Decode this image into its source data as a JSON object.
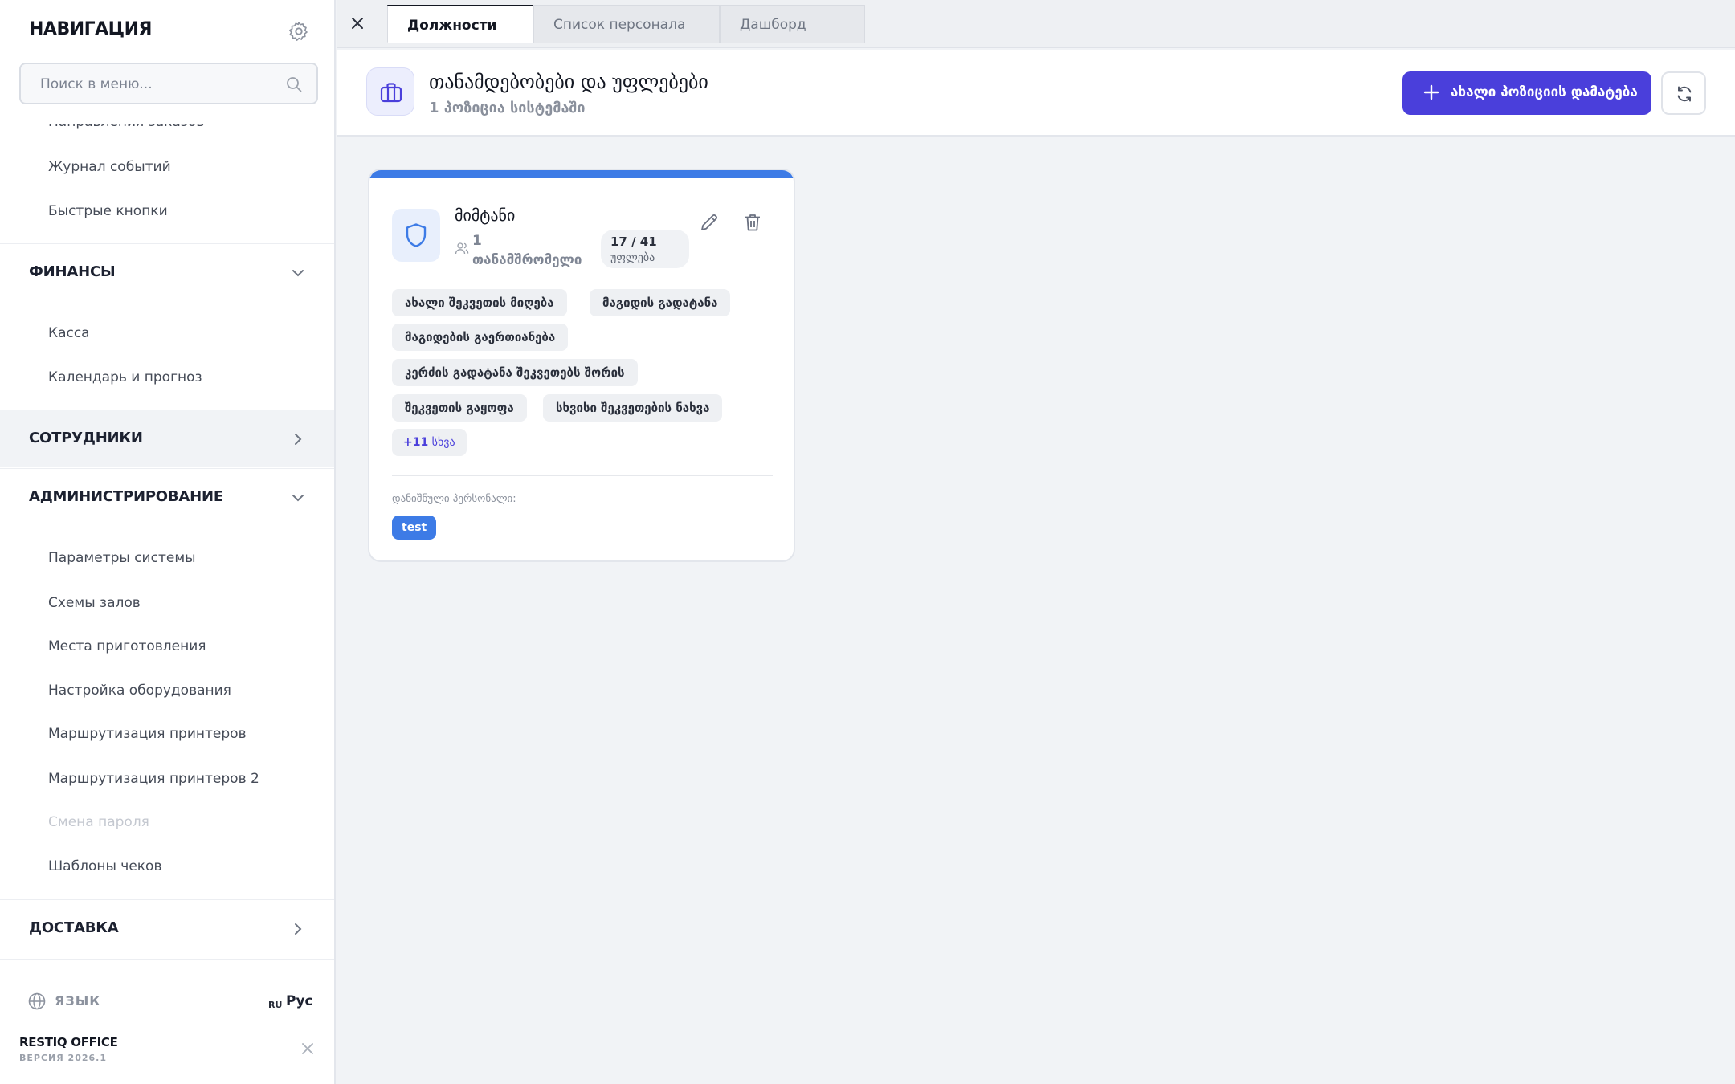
{
  "sidebar": {
    "title": "НАВИГАЦИЯ",
    "search_placeholder": "Поиск в меню...",
    "partial_item": "Направления заказов",
    "top_items": [
      "Журнал событий",
      "Быстрые кнопки"
    ],
    "sections": {
      "finance": {
        "label": "ФИНАНСЫ",
        "items": [
          "Касса",
          "Календарь и прогноз"
        ]
      },
      "employees": {
        "label": "СОТРУДНИКИ"
      },
      "admin": {
        "label": "АДМИНИСТРИРОВАНИЕ",
        "items": [
          "Параметры системы",
          "Схемы залов",
          "Места приготовления",
          "Настройка оборудования",
          "Маршрутизация принтеров",
          "Маршрутизация принтеров 2",
          "Смена пароля",
          "Шаблоны чеков"
        ]
      },
      "delivery": {
        "label": "ДОСТАВКА"
      }
    },
    "footer": {
      "language_label": "ЯЗЫК",
      "language_code": "RU",
      "language_value": "Рус",
      "brand": "RESTIQ OFFICE",
      "version": "ВЕРСИЯ 2026.1"
    }
  },
  "tabs": [
    {
      "label": "Должности",
      "active": true
    },
    {
      "label": "Список персонала",
      "active": false
    },
    {
      "label": "Дашборд",
      "active": false
    }
  ],
  "header": {
    "title": "თანამდებობები და უფლებები",
    "subtitle": "1 პოზიცია სისტემაში",
    "add_button": "ახალი პოზიციის დამატება",
    "accent_color": "#4a3fdb"
  },
  "card": {
    "accent_color": "#3d7be6",
    "title": "მიმტანი",
    "employees_count": "1",
    "employees_label": "თანამშრომელი",
    "permissions": "17 / 41",
    "permissions_label": "უფლება",
    "chips": [
      "ახალი შეკვეთის მიღება",
      "მაგიდის გადატანა",
      "მაგიდების გაერთიანება",
      "კერძის გადატანა შეკვეთებს შორის",
      "შეკვეთის გაყოფა",
      "სხვისი შეკვეთების ნახვა"
    ],
    "more_count": "+11",
    "more_label": "სხვა",
    "assigned_label": "დანიშნული პერსონალი:",
    "assigned_tag": "test"
  }
}
